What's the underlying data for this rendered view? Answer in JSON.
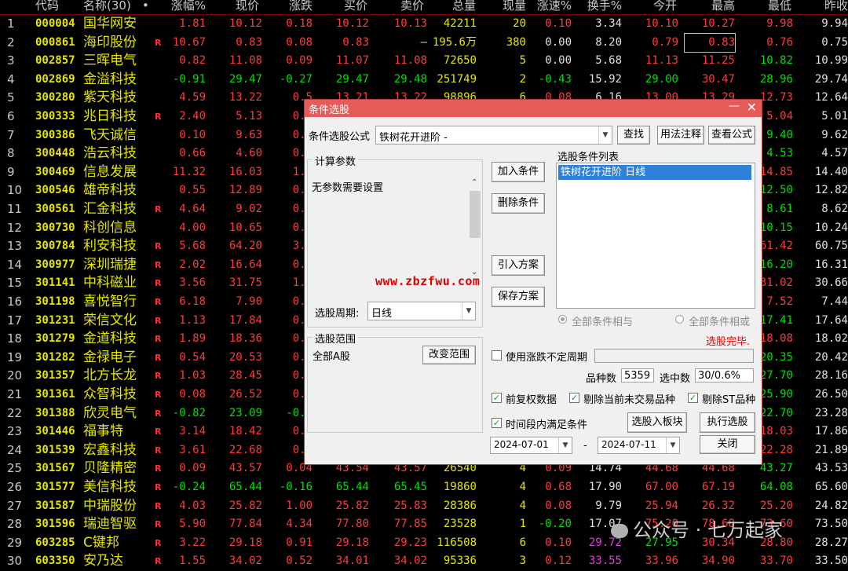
{
  "headers": [
    "代码",
    "名称(30)",
    "•",
    "涨幅%",
    "现价",
    "涨跌",
    "买价",
    "卖价",
    "总量",
    "现量",
    "涨速%",
    "换手%",
    "今开",
    "最高",
    "最低",
    "昨收"
  ],
  "rows": [
    [
      "1",
      "000004",
      "国华网安",
      "",
      "1.81",
      "10.12",
      "0.18",
      "10.12",
      "10.13",
      "42211",
      "20",
      "0.10",
      "3.34",
      "10.10",
      "10.27",
      "9.98",
      "9.94"
    ],
    [
      "2",
      "000861",
      "海印股份",
      "R",
      "10.67",
      "0.83",
      "0.08",
      "0.83",
      "–",
      "195.6万",
      "380",
      "0.00",
      "8.20",
      "0.79",
      "0.83",
      "0.76",
      "0.75"
    ],
    [
      "3",
      "002857",
      "三晖电气",
      "",
      "0.82",
      "11.08",
      "0.09",
      "11.07",
      "11.08",
      "72650",
      "5",
      "0.00",
      "5.68",
      "11.13",
      "11.25",
      "10.82",
      "10.99"
    ],
    [
      "4",
      "002869",
      "金溢科技",
      "",
      "-0.91",
      "29.47",
      "-0.27",
      "29.47",
      "29.48",
      "251749",
      "2",
      "-0.43",
      "15.92",
      "29.00",
      "30.47",
      "28.96",
      "29.74"
    ],
    [
      "5",
      "300280",
      "紫天科技",
      "",
      "4.59",
      "13.22",
      "0.5",
      "13.21",
      "13.22",
      "98896",
      "6",
      "0.08",
      "6.16",
      "13.00",
      "13.29",
      "12.73",
      "12.64"
    ],
    [
      "6",
      "300333",
      "兆日科技",
      "R",
      "2.40",
      "5.13",
      "0.1",
      "",
      "",
      "",
      "",
      "",
      "",
      "",
      "",
      "5.04",
      "5.01"
    ],
    [
      "7",
      "300386",
      "飞天诚信",
      "",
      "0.10",
      "9.63",
      "0.0",
      "",
      "",
      "",
      "",
      "",
      "",
      "",
      "",
      "9.40",
      "9.62"
    ],
    [
      "8",
      "300448",
      "浩云科技",
      "",
      "0.66",
      "4.60",
      "0.0",
      "",
      "",
      "",
      "",
      "",
      "",
      "",
      "",
      "4.53",
      "4.57"
    ],
    [
      "9",
      "300469",
      "信息发展",
      "",
      "11.32",
      "16.03",
      "1.6",
      "",
      "",
      "",
      "",
      "",
      "",
      "",
      "",
      "14.85",
      "14.40"
    ],
    [
      "10",
      "300546",
      "雄帝科技",
      "",
      "0.55",
      "12.89",
      "0.0",
      "",
      "",
      "",
      "",
      "",
      "",
      "",
      "",
      "12.50",
      "12.82"
    ],
    [
      "11",
      "300561",
      "汇金科技",
      "R",
      "4.64",
      "9.02",
      "0.4",
      "",
      "",
      "",
      "",
      "",
      "",
      "",
      "",
      "8.61",
      "8.62"
    ],
    [
      "12",
      "300730",
      "科创信息",
      "",
      "4.00",
      "10.65",
      "0.4",
      "",
      "",
      "",
      "",
      "",
      "",
      "",
      "",
      "10.15",
      "10.24"
    ],
    [
      "13",
      "300784",
      "利安科技",
      "R",
      "5.68",
      "64.20",
      "3.4",
      "",
      "",
      "",
      "",
      "",
      "",
      "",
      "",
      "61.42",
      "60.75"
    ],
    [
      "14",
      "300977",
      "深圳瑞捷",
      "R",
      "2.02",
      "16.64",
      "0.3",
      "",
      "",
      "",
      "",
      "",
      "",
      "",
      "",
      "16.20",
      "16.31"
    ],
    [
      "15",
      "301141",
      "中科磁业",
      "R",
      "3.56",
      "31.75",
      "1.0",
      "",
      "",
      "",
      "",
      "",
      "",
      "",
      "",
      "31.02",
      "30.66"
    ],
    [
      "16",
      "301198",
      "喜悦智行",
      "R",
      "6.18",
      "7.90",
      "0.4",
      "",
      "",
      "",
      "",
      "",
      "",
      "",
      "",
      "7.52",
      "7.44"
    ],
    [
      "17",
      "301231",
      "荣信文化",
      "R",
      "1.13",
      "17.84",
      "0.2",
      "",
      "",
      "",
      "",
      "",
      "",
      "",
      "",
      "17.41",
      "17.64"
    ],
    [
      "18",
      "301279",
      "金道科技",
      "R",
      "1.89",
      "18.36",
      "0.3",
      "",
      "",
      "",
      "",
      "",
      "",
      "",
      "",
      "18.08",
      "18.02"
    ],
    [
      "19",
      "301282",
      "金禄电子",
      "R",
      "0.54",
      "20.53",
      "0.1",
      "",
      "",
      "",
      "",
      "",
      "",
      "",
      "",
      "20.35",
      "20.42"
    ],
    [
      "20",
      "301357",
      "北方长龙",
      "R",
      "1.03",
      "28.45",
      "0.2",
      "",
      "",
      "",
      "",
      "",
      "",
      "",
      "",
      "27.70",
      "28.16"
    ],
    [
      "21",
      "301361",
      "众智科技",
      "R",
      "0.08",
      "26.52",
      "0.0",
      "",
      "",
      "",
      "",
      "",
      "",
      "",
      "",
      "25.90",
      "26.50"
    ],
    [
      "22",
      "301388",
      "欣灵电气",
      "R",
      "-0.82",
      "23.09",
      "-0.1",
      "",
      "",
      "",
      "",
      "",
      "",
      "",
      "",
      "22.70",
      "23.28"
    ],
    [
      "23",
      "301446",
      "福事特",
      "R",
      "3.14",
      "18.42",
      "0.5",
      "",
      "",
      "",
      "",
      "",
      "",
      "",
      "",
      "18.03",
      "17.86"
    ],
    [
      "24",
      "301539",
      "宏鑫科技",
      "R",
      "3.61",
      "22.68",
      "0.7",
      "",
      "",
      "",
      "",
      "",
      "",
      "",
      "",
      "22.28",
      "21.89"
    ],
    [
      "25",
      "301567",
      "贝隆精密",
      "R",
      "0.09",
      "43.57",
      "0.04",
      "43.54",
      "43.57",
      "26540",
      "4",
      "0.09",
      "14.74",
      "44.68",
      "44.68",
      "43.27",
      "43.53"
    ],
    [
      "26",
      "301577",
      "美信科技",
      "R",
      "-0.24",
      "65.44",
      "-0.16",
      "65.44",
      "65.45",
      "19860",
      "4",
      "0.68",
      "17.90",
      "67.00",
      "67.19",
      "64.08",
      "65.60"
    ],
    [
      "27",
      "301587",
      "中瑞股份",
      "R",
      "4.03",
      "25.82",
      "1.00",
      "25.82",
      "25.83",
      "28386",
      "4",
      "0.08",
      "9.79",
      "25.94",
      "26.32",
      "25.20",
      "24.82"
    ],
    [
      "28",
      "301596",
      "瑞迪智驱",
      "R",
      "5.90",
      "77.84",
      "4.34",
      "77.80",
      "77.85",
      "23528",
      "1",
      "-0.20",
      "17.07",
      "75.20",
      "78.68",
      "73.60",
      "73.50"
    ],
    [
      "29",
      "603285",
      "C键邦",
      "R",
      "3.22",
      "29.18",
      "0.91",
      "29.18",
      "29.23",
      "116508",
      "6",
      "0.10",
      "29.72",
      "27.95",
      "30.34",
      "28.80",
      "28.27"
    ],
    [
      "30",
      "603350",
      "安乃达",
      "R",
      "1.55",
      "34.02",
      "0.52",
      "34.01",
      "34.02",
      "95336",
      "3",
      "0.12",
      "33.55",
      "33.96",
      "34.90",
      "33.70",
      "33.50"
    ]
  ],
  "dialog": {
    "title": "条件选股",
    "formula_label": "条件选股公式",
    "formula_value": "铁树花开进阶  -",
    "btn_find": "查找",
    "btn_usage": "用法注释",
    "btn_view": "查看公式",
    "params_group": "计算参数",
    "params_text": "无参数需要设置",
    "btn_add": "加入条件",
    "btn_del": "删除条件",
    "btn_import": "引入方案",
    "btn_save": "保存方案",
    "cond_list_label": "选股条件列表",
    "cond_items": [
      "铁树花开进阶  日线"
    ],
    "period_label": "选股周期:",
    "period_value": "日线",
    "radio_and": "全部条件相与",
    "radio_or": "全部条件相或",
    "done_text": "选股完毕.",
    "range_group": "选股范围",
    "range_value": "全部A股",
    "btn_change_range": "改变范围",
    "chk_variable_period": "使用涨跌不定周期",
    "count_label": "品种数",
    "count_value": "5359",
    "selected_label": "选中数",
    "selected_value": "30/0.6%",
    "chk_fq": "前复权数据",
    "chk_notrade": "剔除当前未交易品种",
    "chk_st": "剔除ST品种",
    "chk_timerange": "时间段内满足条件",
    "btn_to_block": "选股入板块",
    "btn_execute": "执行选股",
    "date_from": "2024-07-01",
    "date_sep": "-",
    "date_to": "2024-07-11",
    "btn_close": "关闭"
  },
  "watermark_site": "www.zbzfwu.com",
  "watermark_account": "公众号 · 七万起家",
  "colors": {
    "up": "#ff3b3b",
    "down": "#00e000",
    "flat": "#e0e0e0",
    "code": "#e6e600",
    "dialog_title": "#e85a5a"
  }
}
